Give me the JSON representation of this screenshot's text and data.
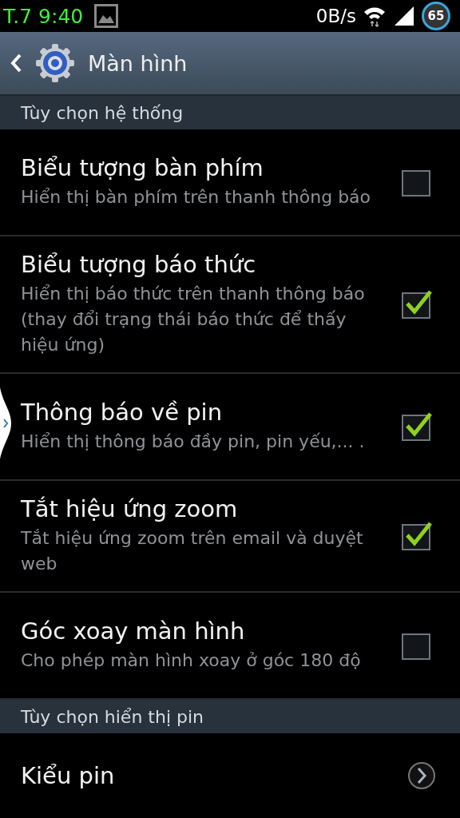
{
  "status_bar": {
    "time": "T.7 9:40",
    "net_speed": "0B/s",
    "battery": "65"
  },
  "action_bar": {
    "title": "Màn hình"
  },
  "sections": [
    {
      "header": "Tùy chọn hệ thống",
      "items": [
        {
          "kind": "checkbox",
          "title": "Biểu tượng bàn phím",
          "summary": "Hiển thị bàn phím trên thanh thông báo",
          "checked": false
        },
        {
          "kind": "checkbox",
          "title": "Biểu tượng báo thức",
          "summary": "Hiển thị báo thức trên thanh thông báo (thay đổi trạng thái báo thức để thấy hiệu ứng)",
          "checked": true
        },
        {
          "kind": "checkbox",
          "title": "Thông báo về pin",
          "summary": "Hiển thị thông báo đầy pin, pin yếu,... .",
          "checked": true
        },
        {
          "kind": "checkbox",
          "title": "Tắt hiệu ứng zoom",
          "summary": "Tắt hiệu ứng zoom trên email và duyệt web",
          "checked": true
        },
        {
          "kind": "checkbox",
          "title": "Góc xoay màn hình",
          "summary": "Cho phép màn hình xoay ở góc 180 độ",
          "checked": false
        }
      ]
    },
    {
      "header": "Tùy chọn hiển thị pin",
      "items": [
        {
          "kind": "link",
          "title": "Kiểu pin"
        }
      ]
    }
  ]
}
